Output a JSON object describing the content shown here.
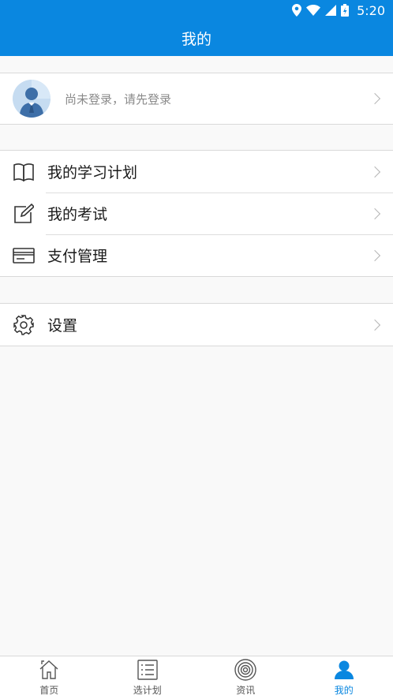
{
  "status": {
    "time": "5:20"
  },
  "header": {
    "title": "我的"
  },
  "profile": {
    "text": "尚未登录，请先登录"
  },
  "menu": {
    "study_plan": "我的学习计划",
    "exam": "我的考试",
    "payment": "支付管理",
    "settings": "设置"
  },
  "tabs": [
    {
      "label": "首页",
      "icon": "home-icon"
    },
    {
      "label": "选计划",
      "icon": "list-icon"
    },
    {
      "label": "资讯",
      "icon": "target-icon"
    },
    {
      "label": "我的",
      "icon": "user-icon",
      "active": true
    }
  ],
  "colors": {
    "brand": "#0a87e0"
  }
}
